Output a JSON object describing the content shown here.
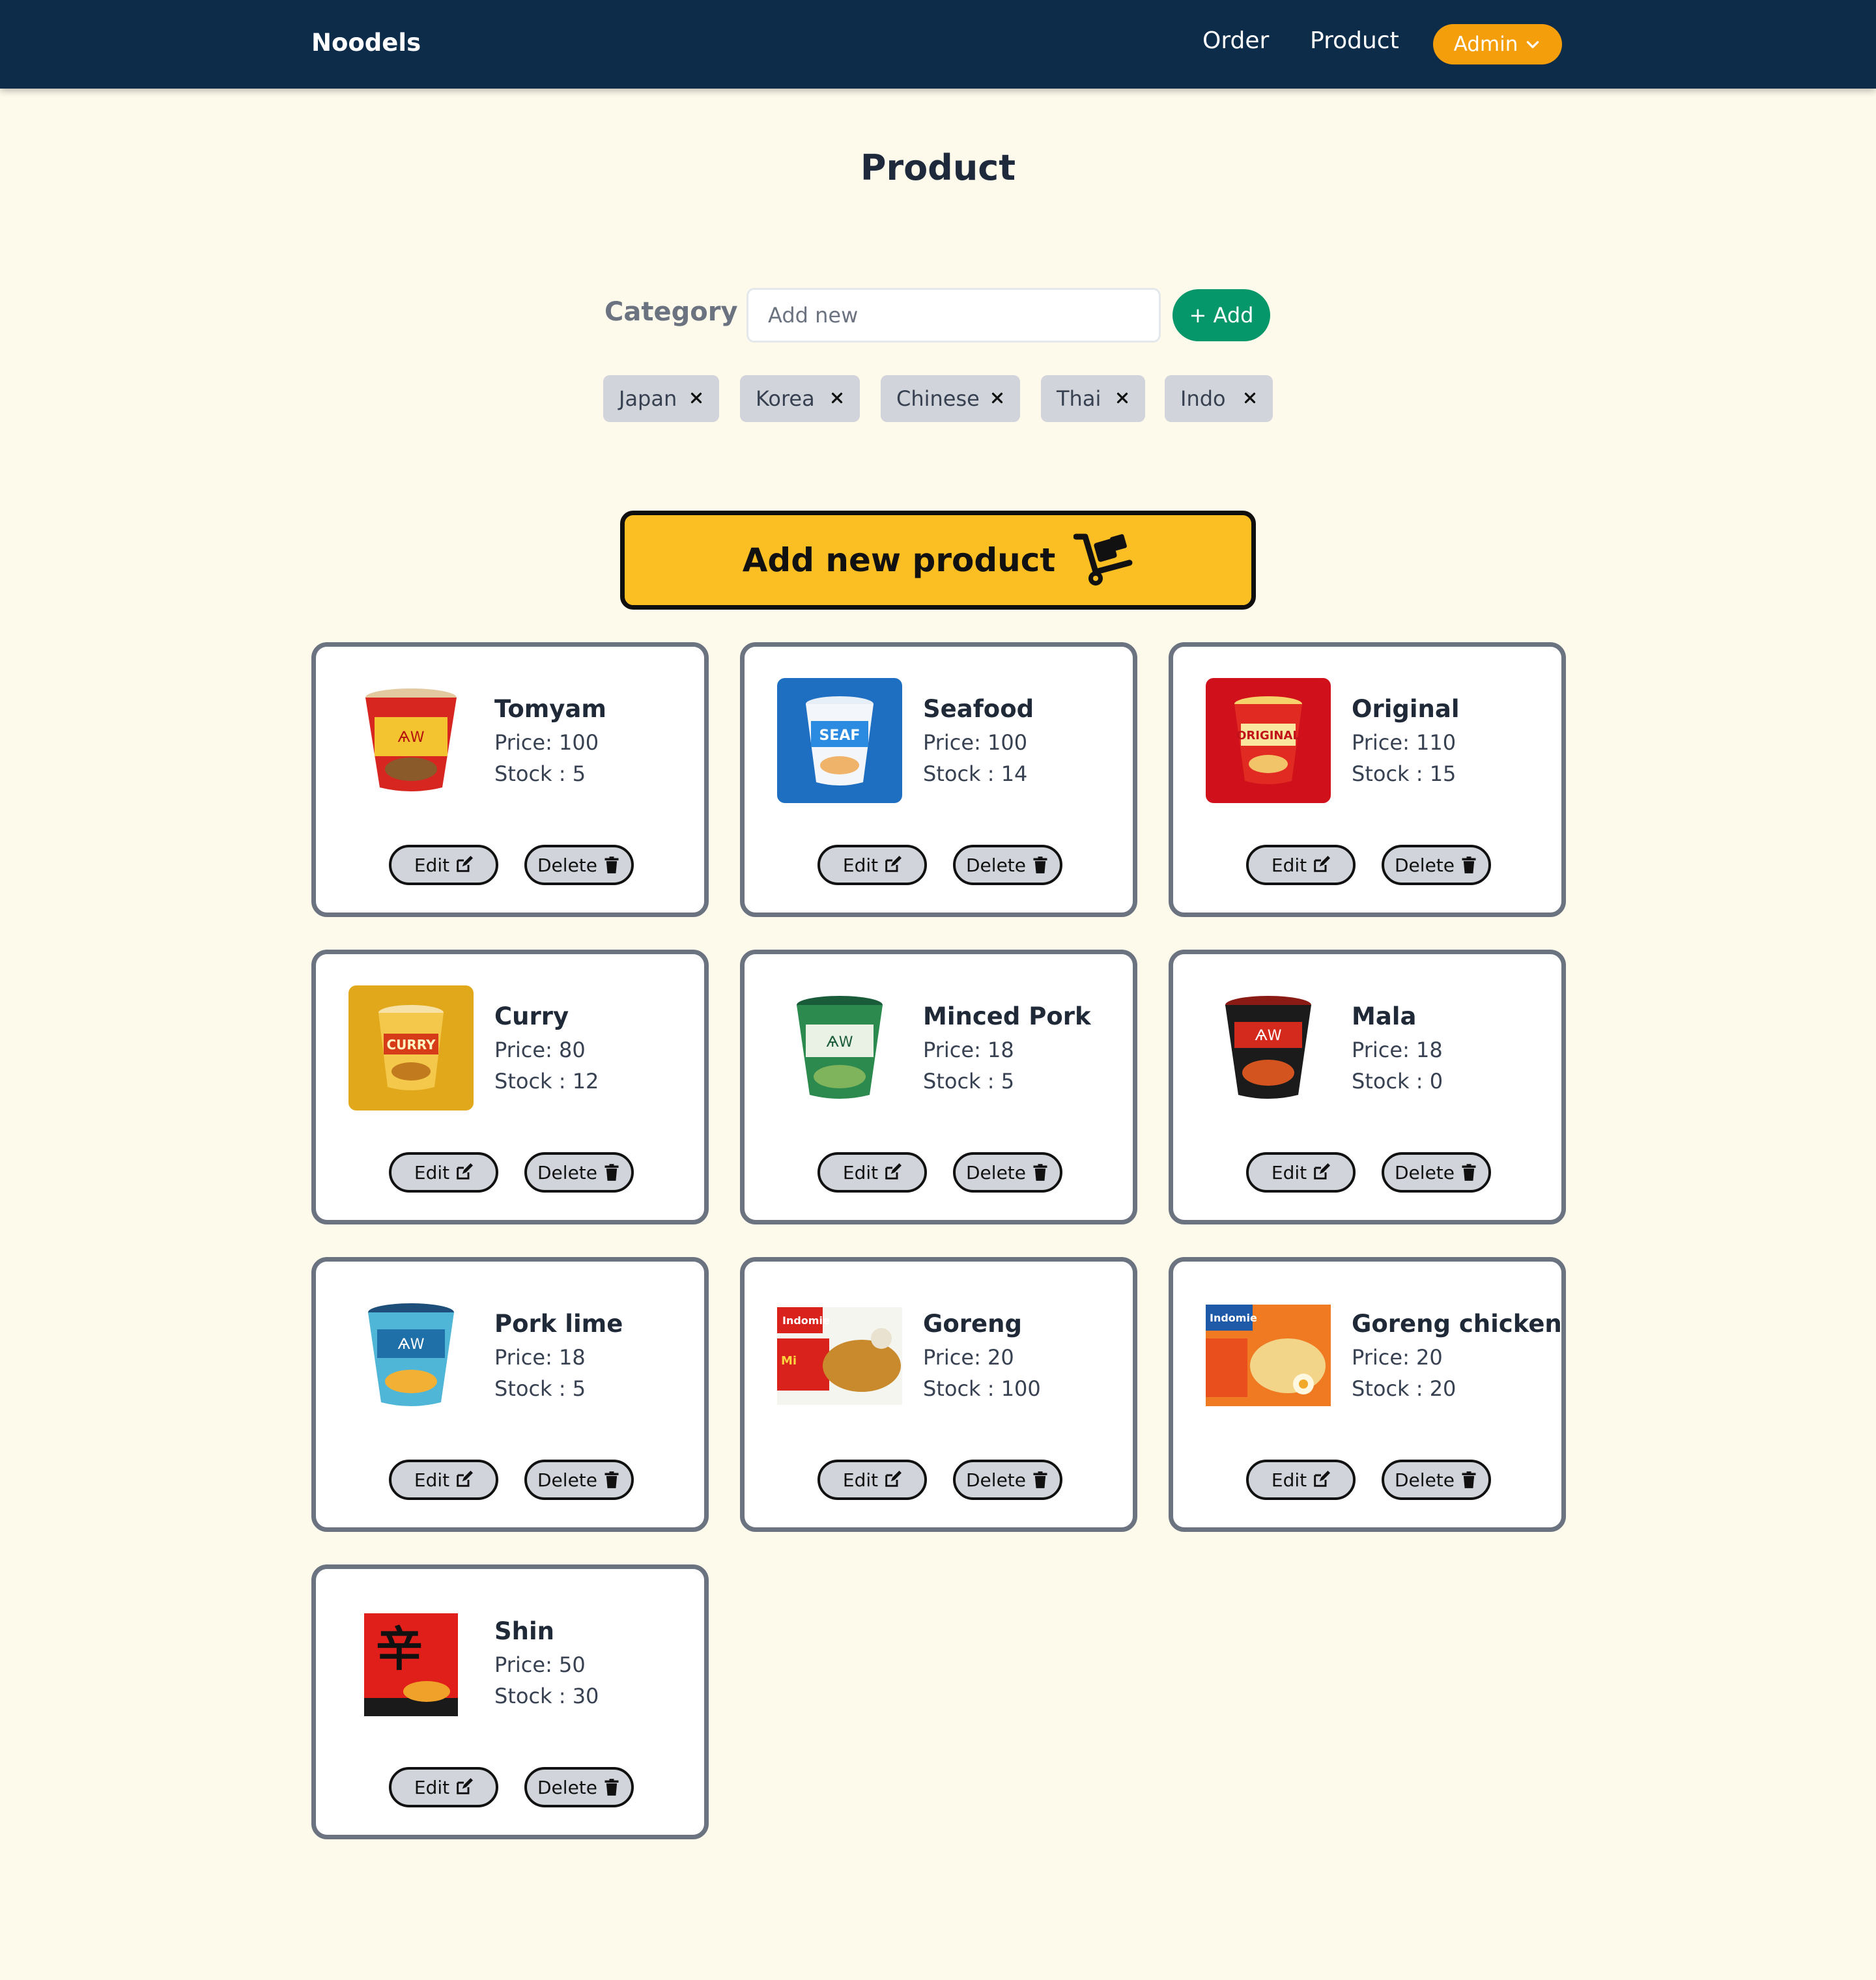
{
  "navbar": {
    "brand": "Noodels",
    "links": [
      "Order",
      "Product"
    ],
    "admin_label": "Admin",
    "admin_color": "#f59e0b",
    "background": "#0d2c4a"
  },
  "page": {
    "title": "Product",
    "background": "#fefaeb"
  },
  "category": {
    "label": "Category :",
    "input_placeholder": "Add new",
    "add_button": "+ Add",
    "chips": [
      "Japan",
      "Korea",
      "Chinese",
      "Thai",
      "Indo"
    ]
  },
  "add_product_button": "Add new product",
  "card_buttons": {
    "edit": "Edit",
    "delete": "Delete"
  },
  "products": [
    {
      "name": "Tomyam",
      "price": "Price: 100",
      "stock": "Stock : 5",
      "image": "cup-red-noodle-icon"
    },
    {
      "name": "Seafood",
      "price": "Price: 100",
      "stock": "Stock : 14",
      "image": "cup-blue-noodle-icon"
    },
    {
      "name": "Original",
      "price": "Price: 110",
      "stock": "Stock : 15",
      "image": "cup-original-noodle-icon"
    },
    {
      "name": "Curry",
      "price": "Price: 80",
      "stock": "Stock : 12",
      "image": "cup-curry-noodle-icon"
    },
    {
      "name": "Minced Pork",
      "price": "Price: 18",
      "stock": "Stock : 5",
      "image": "cup-green-noodle-icon"
    },
    {
      "name": "Mala",
      "price": "Price: 18",
      "stock": "Stock : 0",
      "image": "cup-black-noodle-icon"
    },
    {
      "name": "Pork lime",
      "price": "Price: 18",
      "stock": "Stock : 5",
      "image": "cup-teal-noodle-icon"
    },
    {
      "name": "Goreng",
      "price": "Price: 20",
      "stock": "Stock : 100",
      "image": "pack-goreng-noodle-icon"
    },
    {
      "name": "Goreng chicken",
      "price": "Price: 20",
      "stock": "Stock : 20",
      "image": "pack-goreng-chicken-noodle-icon"
    },
    {
      "name": "Shin",
      "price": "Price: 50",
      "stock": "Stock : 30",
      "image": "pack-shin-noodle-icon"
    }
  ]
}
